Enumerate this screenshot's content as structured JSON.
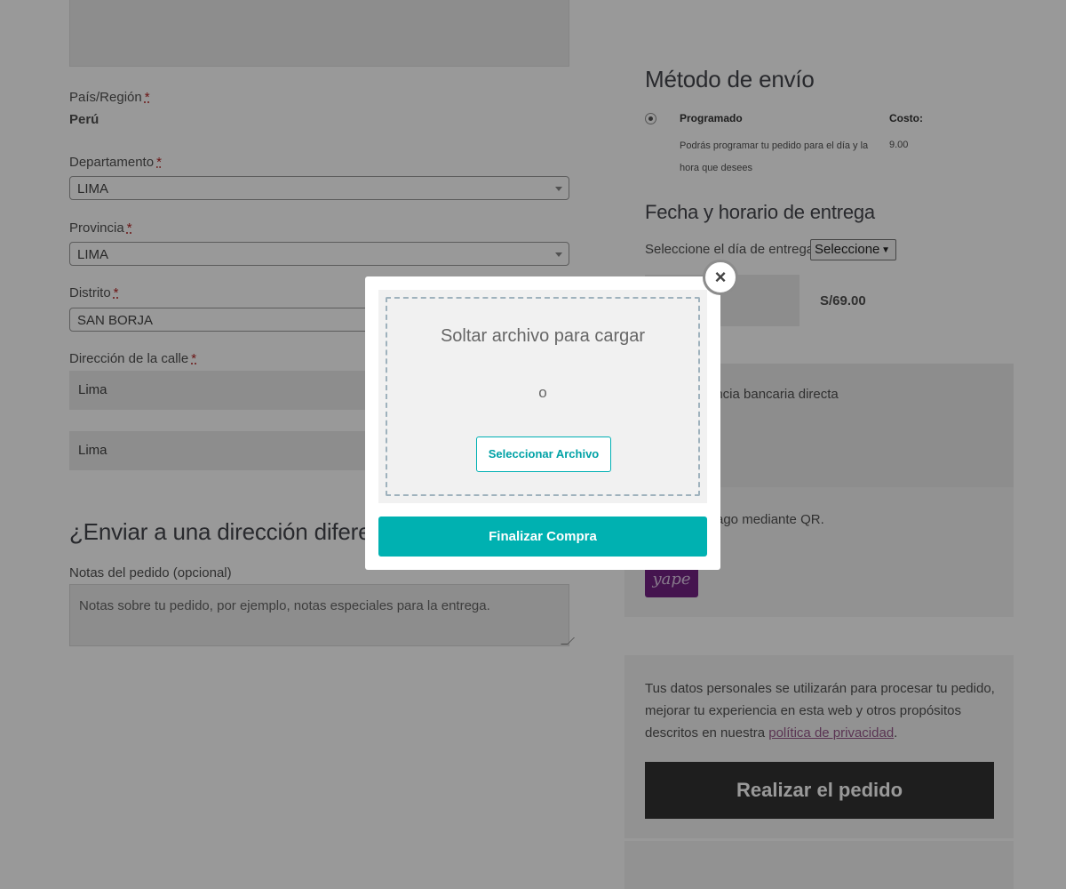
{
  "billing": {
    "country_label": "País/Región",
    "country_value": "Perú",
    "department_label": "Departamento",
    "department_value": "LIMA",
    "province_label": "Provincia",
    "province_value": "LIMA",
    "district_label": "Distrito",
    "district_value": "SAN BORJA",
    "street_label": "Dirección de la calle",
    "street_value_1": "Lima",
    "street_value_2": "Lima",
    "required_mark": "*"
  },
  "ship_to_different": {
    "heading": "¿Enviar a una dirección diferente?"
  },
  "order_notes": {
    "label": "Notas del pedido (opcional)",
    "placeholder": "Notas sobre tu pedido, por ejemplo, notas especiales para la entrega."
  },
  "shipping_method": {
    "heading": "Método de envío",
    "option_name": "Programado",
    "cost_label": "Costo:",
    "option_description": "Podrás programar tu pedido para el día y la hora que desees",
    "cost_value": "9.00"
  },
  "delivery": {
    "heading": "Fecha y horario de entrega",
    "day_label": "Seleccione el día de entrega",
    "day_select_value": "Seleccione"
  },
  "summary": {
    "total": "S/69.00"
  },
  "payment": {
    "bank_transfer_text": "rencia bancaria directa",
    "qr_text": "ago mediante QR.",
    "yape_logo_text": "yape"
  },
  "privacy": {
    "text_before_link": "Tus datos personales se utilizarán para procesar tu pedido, mejorar tu experiencia en esta web y otros propósitos descritos en nuestra ",
    "link_text": "política de privacidad",
    "text_after_link": "."
  },
  "place_order_label": "Realizar el pedido",
  "modal": {
    "close_symbol": "×",
    "drop_title": "Soltar archivo para cargar",
    "or_text": "o",
    "select_file_label": "Seleccionar Archivo",
    "finalize_label": "Finalizar Compra"
  },
  "colors": {
    "accent_teal": "#00b1b1",
    "place_order_bg": "#333333",
    "privacy_link": "#96588a",
    "yape_purple": "#742284"
  }
}
